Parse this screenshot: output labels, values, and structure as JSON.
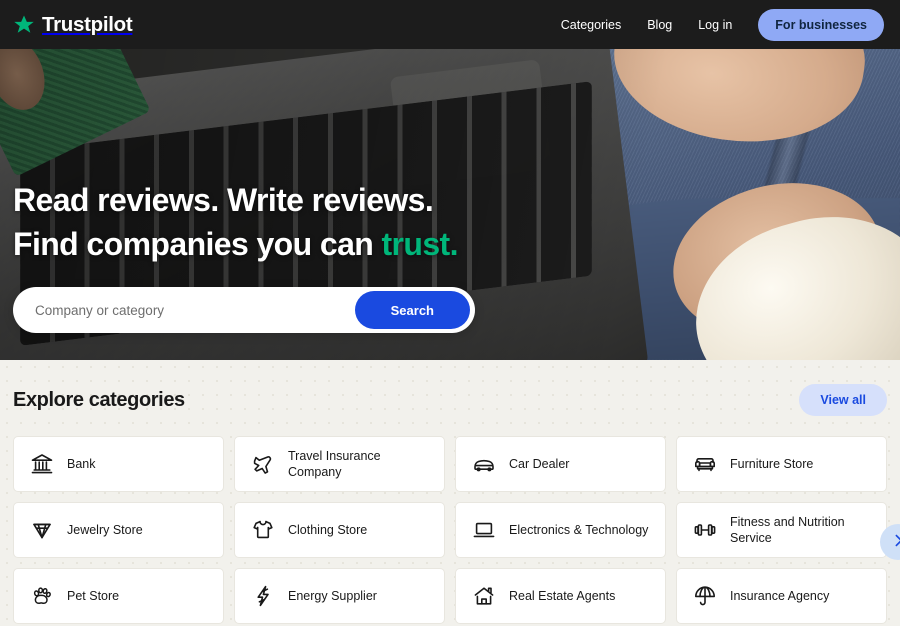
{
  "header": {
    "brand": "Trustpilot",
    "brand_star_icon": "star-icon",
    "nav": [
      {
        "label": "Categories",
        "name": "nav-link-categories"
      },
      {
        "label": "Blog",
        "name": "nav-link-blog"
      },
      {
        "label": "Log in",
        "name": "nav-link-login"
      }
    ],
    "business_button": "For businesses"
  },
  "hero": {
    "title_line1": "Read reviews. Write reviews.",
    "title_line2_prefix": "Find companies you can ",
    "title_line2_accent": "trust.",
    "search_placeholder": "Company or category",
    "search_value": "",
    "search_button": "Search"
  },
  "categories": {
    "title": "Explore categories",
    "view_all": "View all",
    "next_arrow_icon": "chevron-right-icon",
    "items": [
      {
        "label": "Bank",
        "icon": "bank-icon"
      },
      {
        "label": "Travel Insurance Company",
        "icon": "airplane-icon"
      },
      {
        "label": "Car Dealer",
        "icon": "car-icon"
      },
      {
        "label": "Furniture Store",
        "icon": "armchair-icon"
      },
      {
        "label": "Jewelry Store",
        "icon": "diamond-icon"
      },
      {
        "label": "Clothing Store",
        "icon": "tshirt-icon"
      },
      {
        "label": "Electronics & Technology",
        "icon": "laptop-icon"
      },
      {
        "label": "Fitness and Nutrition Service",
        "icon": "dumbbell-icon"
      },
      {
        "label": "Pet Store",
        "icon": "paw-icon"
      },
      {
        "label": "Energy Supplier",
        "icon": "lightning-bolt-icon"
      },
      {
        "label": "Real Estate Agents",
        "icon": "house-icon"
      },
      {
        "label": "Insurance Agency",
        "icon": "umbrella-icon"
      }
    ]
  },
  "colors": {
    "header_bg": "#1c1c1c",
    "brand_green": "#00b67a",
    "accent_blue": "#1a4ae0",
    "business_button_bg": "#8fa9f5",
    "view_all_bg": "#d6e0fb",
    "page_bg": "#f2f1ec",
    "card_bg": "#ffffff"
  }
}
